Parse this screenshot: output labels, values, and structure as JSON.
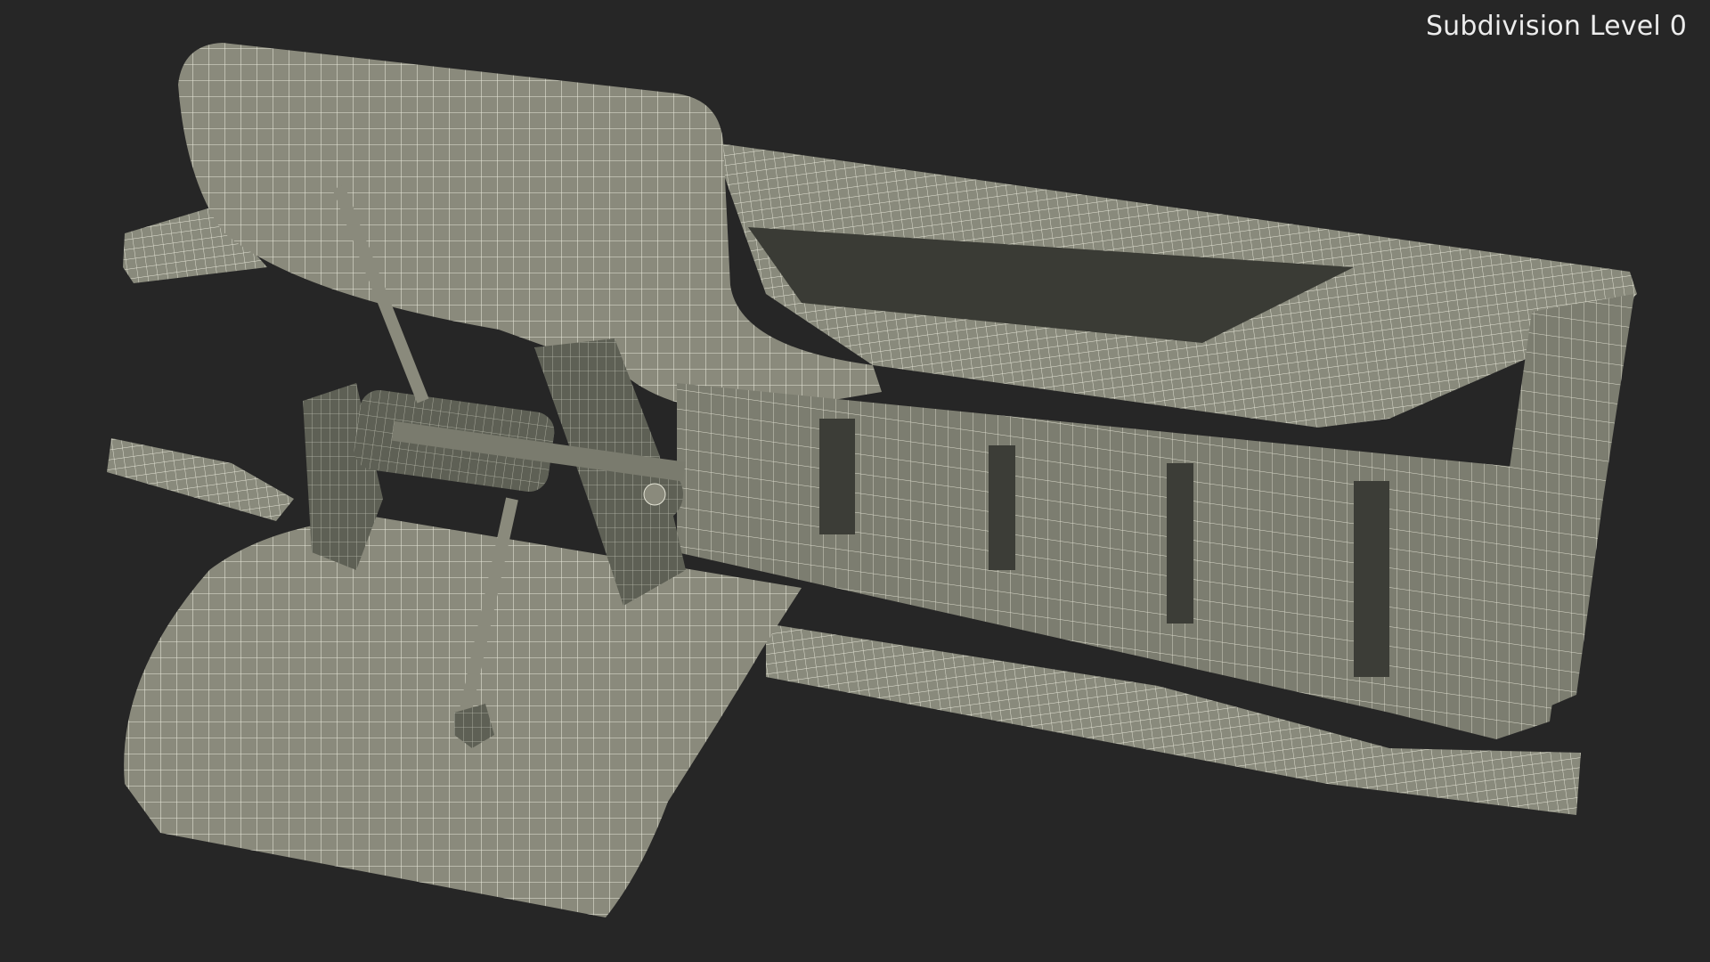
{
  "viewport": {
    "subdivision_label": "Subdivision Level 0",
    "background_color": "#262626",
    "mesh_fill_color": "#8a8a7c",
    "mesh_shadow_color": "#55574c",
    "wire_color": "#e8e8da"
  }
}
